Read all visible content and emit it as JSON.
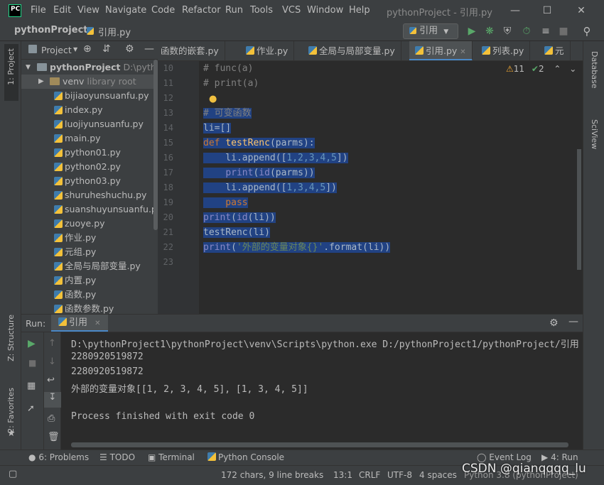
{
  "window": {
    "logo": "PC",
    "menus": [
      "File",
      "Edit",
      "View",
      "Navigate",
      "Code",
      "Refactor",
      "Run",
      "Tools",
      "VCS",
      "Window",
      "Help"
    ],
    "title": "pythonProject - 引用.py",
    "controls": [
      "minimize-icon",
      "maximize-icon",
      "close-icon"
    ]
  },
  "navbar": {
    "project": "pythonProject",
    "file": "引用.py",
    "run_config": "引用"
  },
  "left_stripe": [
    "1: Project",
    "Z: Structure",
    "2: Favorites"
  ],
  "right_stripe": [
    "Database",
    "SciView"
  ],
  "project_panel": {
    "title": "Project",
    "root_name": "pythonProject",
    "root_path": "D:\\python",
    "venv": "venv",
    "venv_note": "library root",
    "files": [
      "bijiaoyunsuanfu.py",
      "index.py",
      "luojiyunsuanfu.py",
      "main.py",
      "python01.py",
      "python02.py",
      "python03.py",
      "shuruheshuchu.py",
      "suanshuyunsuanfu.py",
      "zuoye.py",
      "作业.py",
      "元组.py",
      "全局与局部变量.py",
      "内置.py",
      "函数.py",
      "函数参数.py"
    ]
  },
  "tabs": [
    "函数的嵌套.py",
    "作业.py",
    "全局与局部变量.py",
    "引用.py",
    "列表.py",
    "元"
  ],
  "active_tab": "引用.py",
  "inspections": {
    "warnings": "11",
    "weak": "2"
  },
  "editor": {
    "line_numbers": [
      "10",
      "11",
      "12",
      "13",
      "14",
      "15",
      "16",
      "17",
      "18",
      "19",
      "20",
      "21",
      "22",
      "23"
    ],
    "l10": "# func(a)",
    "l11": "# print(a)",
    "l13": "# 可变函数",
    "l14": "li=[]",
    "l15_kw": "def",
    "l15_fn": "testRenc",
    "l15_rest": "(parms):",
    "l16_a": "    li.append([",
    "l16_nums": "1,2,3,4,5",
    "l16_b": "])",
    "l17_a": "    ",
    "l17_fn": "print",
    "l17_b": "(",
    "l17_id": "id",
    "l17_c": "(parms))",
    "l18_a": "    li.append([",
    "l18_nums": "1,3,4,5",
    "l18_b": "])",
    "l19": "    pass",
    "l20_fn": "print",
    "l20_b": "(",
    "l20_id": "id",
    "l20_c": "(li))",
    "l21": "testRenc(li)",
    "l22_fn": "print",
    "l22_b": "(",
    "l22_str": "'外部的变量对象{}'",
    "l22_c": ".format(li))"
  },
  "run": {
    "label": "Run:",
    "config": "引用",
    "output": [
      "D:\\pythonProject1\\pythonProject\\venv\\Scripts\\python.exe D:/pythonProject1/pythonProject/引用",
      "2280920519872",
      "2280920519872",
      "外部的变量对象[[1, 2, 3, 4, 5], [1, 3, 4, 5]]",
      "",
      "Process finished with exit code 0"
    ]
  },
  "bottom_tabs": {
    "problems": "6: Problems",
    "todo": "TODO",
    "terminal": "Terminal",
    "python_console": "Python Console",
    "event_log": "Event Log",
    "run": "4: Run"
  },
  "status": {
    "chars": "172 chars, 9 line breaks",
    "position": "13:1",
    "line_sep": "CRLF",
    "encoding": "UTF-8",
    "indent": "4 spaces",
    "interpreter": "Python 3.8 (pythonProject)"
  },
  "watermark": "CSDN @qianqqqq_lu",
  "colors": {
    "selection": "#214283",
    "accent": "#4a88c7",
    "keyword": "#cc7832",
    "string": "#6a8759",
    "number": "#6897bb"
  }
}
